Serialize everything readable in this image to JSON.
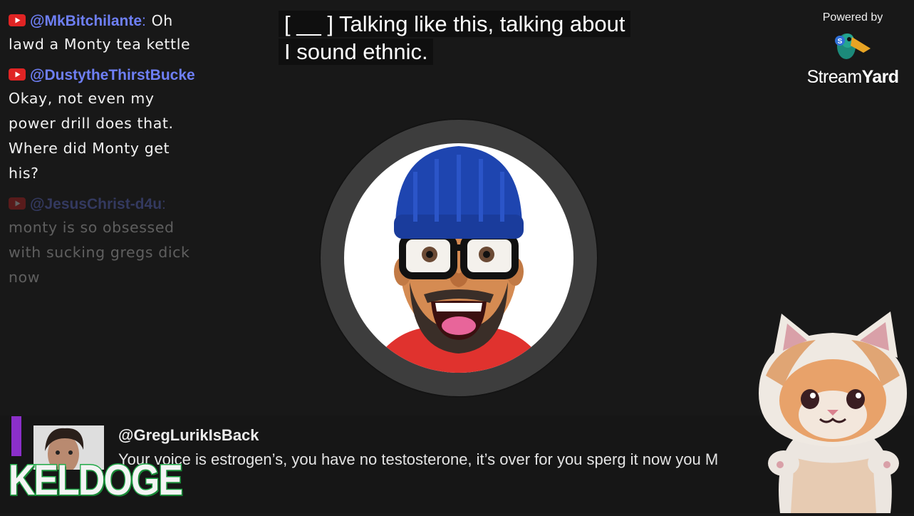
{
  "chat": {
    "messages": [
      {
        "author": "@MkBitchilante",
        "colon": ":",
        "text_lead": "Oh",
        "text_rest": "lawd a Monty tea kettle"
      },
      {
        "author": "@DustytheThirstBucke",
        "text": "Okay, not even my power drill does that. Where did Monty get his?"
      },
      {
        "author": "@JesusChrist-d4u",
        "colon": ":",
        "text": "monty is so obsessed with sucking gregs dick now"
      }
    ]
  },
  "caption": {
    "line1": "[ __ ] Talking like this, talking about",
    "line2": "I sound ethnic."
  },
  "branding": {
    "powered_by": "Powered by",
    "name_light": "Stream",
    "name_bold": "Yard"
  },
  "featured_comment": {
    "author": "@GregLurikIsBack",
    "text": "Your voice is estrogen’s, you have no testosterone, it’s over for you sperg it now you M",
    "accent_color": "#8b2fc9"
  },
  "overlay_label": "KELDOGE",
  "colors": {
    "background": "#181818",
    "chat_author": "#6e7ff5",
    "youtube_red": "#e02424",
    "keldoge_outline": "#22b14c"
  },
  "icons": [
    "youtube-icon",
    "streamyard-logo-icon"
  ]
}
